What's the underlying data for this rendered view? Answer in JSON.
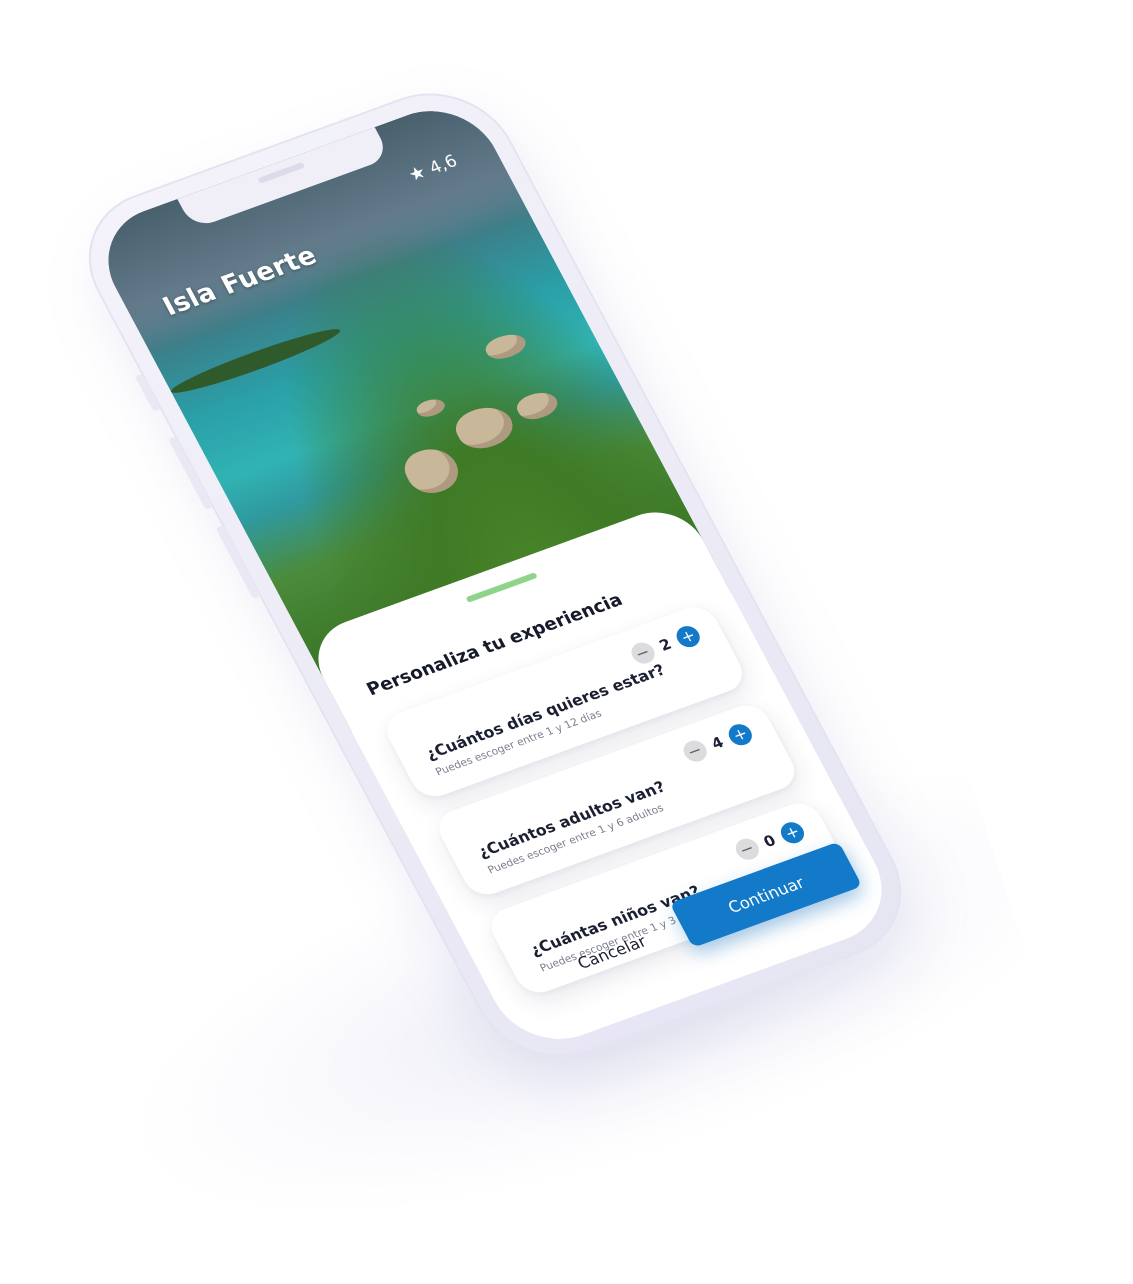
{
  "header": {
    "title": "Isla Fuerte",
    "rating": "4,6",
    "rating_icon": "star-icon"
  },
  "sheet": {
    "title": "Personaliza tu experiencia",
    "handle_color": "#8fd48b",
    "cards": [
      {
        "question": "¿Cuántos días quieres estar?",
        "hint": "Puedes escoger entre 1 y 12 días",
        "value": "2",
        "minus": "−",
        "plus": "+"
      },
      {
        "question": "¿Cuántos adultos van?",
        "hint": "Puedes escoger entre 1 y 6 adultos",
        "value": "4",
        "minus": "−",
        "plus": "+"
      },
      {
        "question": "¿Cuántas niños van?",
        "hint": "Puedes escoger entre 1 y 3 niños",
        "value": "0",
        "minus": "−",
        "plus": "+"
      }
    ]
  },
  "actions": {
    "cancel_label": "Cancelar",
    "continue_label": "Continuar"
  },
  "colors": {
    "accent": "#1379c9",
    "stepper_minus_bg": "#dcdcdf",
    "text_dark": "#1b1f31"
  }
}
